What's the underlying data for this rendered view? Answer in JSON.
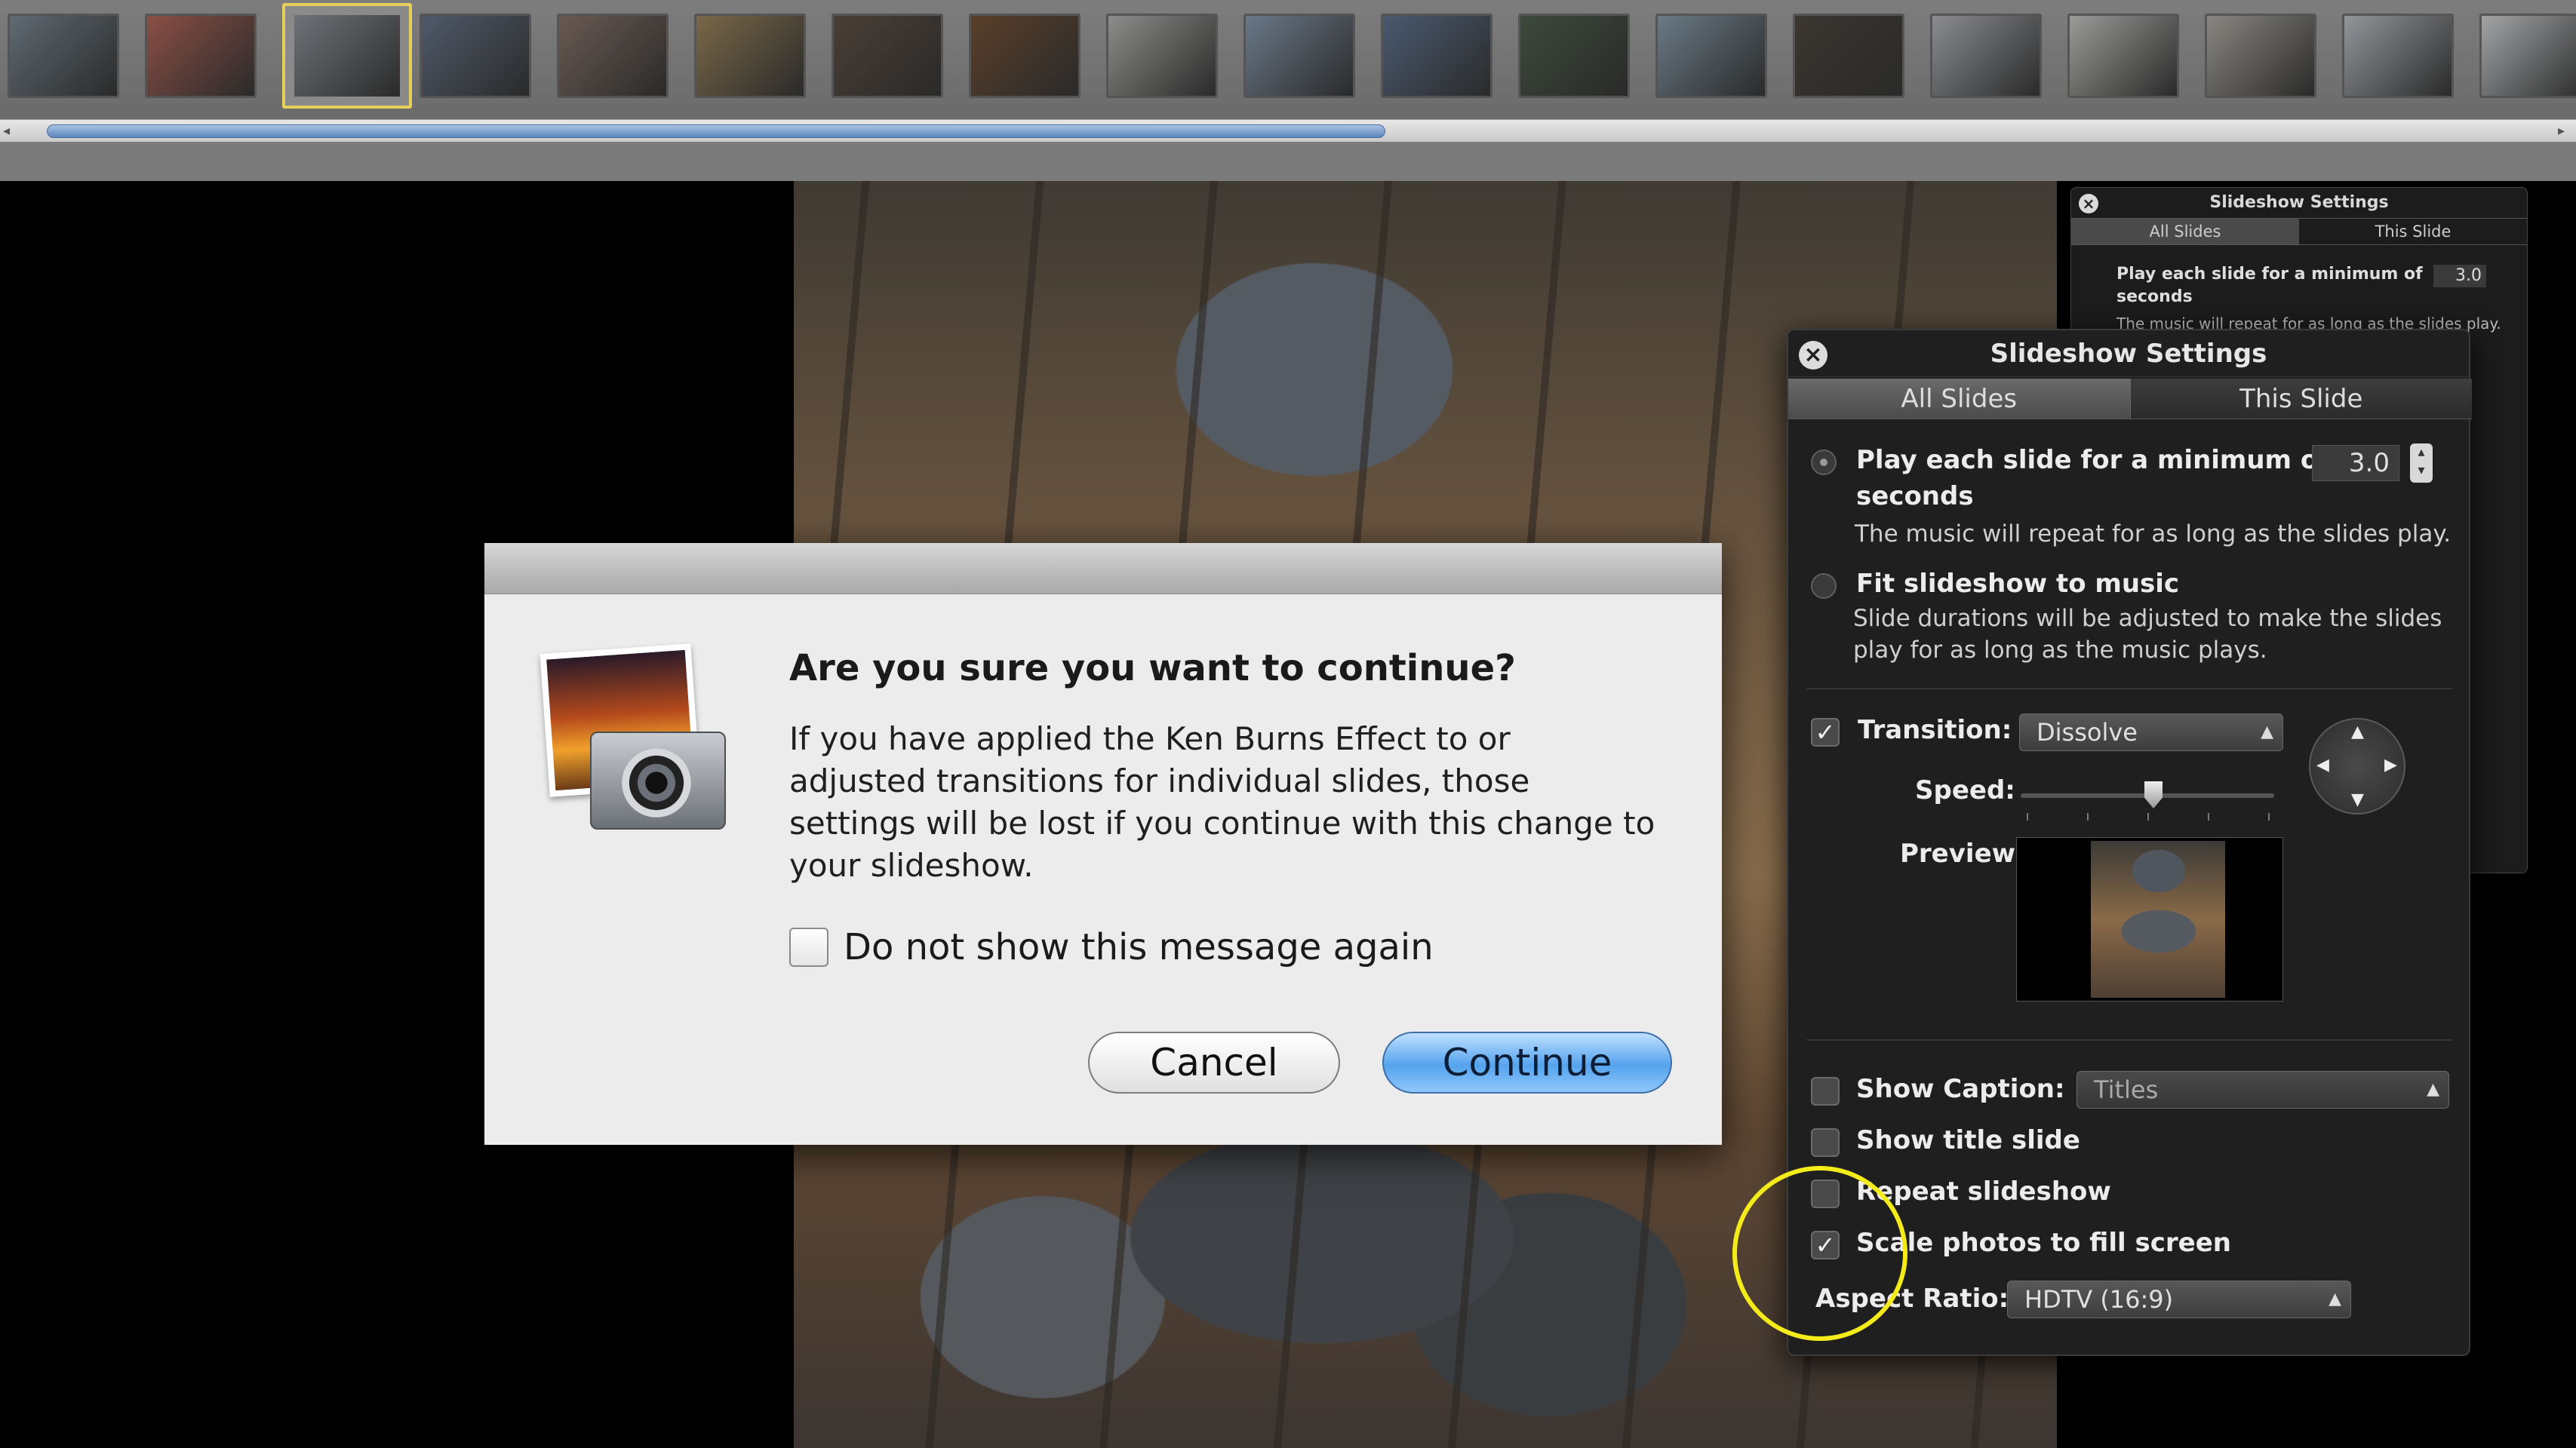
{
  "filmstrip": {
    "thumbnails": [
      {
        "name": "thumb-1",
        "color": "#5f6a72"
      },
      {
        "name": "thumb-2",
        "color": "#8a4f45"
      },
      {
        "name": "thumb-3",
        "color": "#6f7278",
        "selected": true
      },
      {
        "name": "thumb-4",
        "color": "#4f5a6a"
      },
      {
        "name": "thumb-5",
        "color": "#6a5a52"
      },
      {
        "name": "thumb-6",
        "color": "#7a6848"
      },
      {
        "name": "thumb-7",
        "color": "#4a3e35"
      },
      {
        "name": "thumb-8",
        "color": "#5a3f2a"
      },
      {
        "name": "thumb-9",
        "color": "#8c8c8a"
      },
      {
        "name": "thumb-10",
        "color": "#6a7888"
      },
      {
        "name": "thumb-11",
        "color": "#4a5a70"
      },
      {
        "name": "thumb-12",
        "color": "#3c4a3a"
      },
      {
        "name": "thumb-13",
        "color": "#6a7a86"
      },
      {
        "name": "thumb-14",
        "color": "#3b3630"
      },
      {
        "name": "thumb-15",
        "color": "#8a8c90"
      },
      {
        "name": "thumb-16",
        "color": "#9a9a98"
      },
      {
        "name": "thumb-17",
        "color": "#8a8782"
      },
      {
        "name": "thumb-18",
        "color": "#92969a"
      },
      {
        "name": "thumb-19",
        "color": "#a2a4a6"
      }
    ]
  },
  "dialog": {
    "title": "Are you sure you want to continue?",
    "body": "If you have applied the Ken Burns Effect to or adjusted transitions for individual slides, those settings will be lost if you continue with this change to your slideshow.",
    "checkbox_label": "Do not show this message again",
    "checkbox_checked": false,
    "cancel_label": "Cancel",
    "continue_label": "Continue"
  },
  "settings_back": {
    "title": "Slideshow Settings",
    "tab_all": "All Slides",
    "tab_this": "This Slide",
    "play_label": "Play each slide for a minimum of seconds",
    "play_value": "3.0",
    "note": "The music will repeat for as long as the slides play."
  },
  "settings": {
    "title": "Slideshow Settings",
    "tabs": {
      "all_slides": "All Slides",
      "this_slide": "This Slide"
    },
    "play_each": {
      "label_line1": "Play each slide for a minimum of",
      "label_line2": "seconds",
      "value": "3.0",
      "note": "The music will repeat for as long as the slides play.",
      "selected": true
    },
    "fit_music": {
      "label": "Fit slideshow to music",
      "note_line1": "Slide durations will be adjusted to make the slides",
      "note_line2": "play for as long as the music plays.",
      "selected": false
    },
    "transition": {
      "label": "Transition:",
      "value": "Dissolve",
      "checked": true
    },
    "speed": {
      "label": "Speed:"
    },
    "preview": {
      "label": "Preview:"
    },
    "show_caption": {
      "label": "Show Caption:",
      "value": "Titles",
      "checked": false
    },
    "show_title_slide": {
      "label": "Show title slide",
      "checked": false
    },
    "repeat_slideshow": {
      "label": "Repeat slideshow",
      "checked": false
    },
    "scale_photos": {
      "label": "Scale photos to fill screen",
      "checked": true
    },
    "aspect_ratio": {
      "label": "Aspect Ratio:",
      "value": "HDTV (16:9)"
    }
  },
  "colors": {
    "highlight_circle": "#f3ec1a",
    "continue_button": "#55a3ee",
    "selected_thumb_border": "#e6cf5a"
  }
}
